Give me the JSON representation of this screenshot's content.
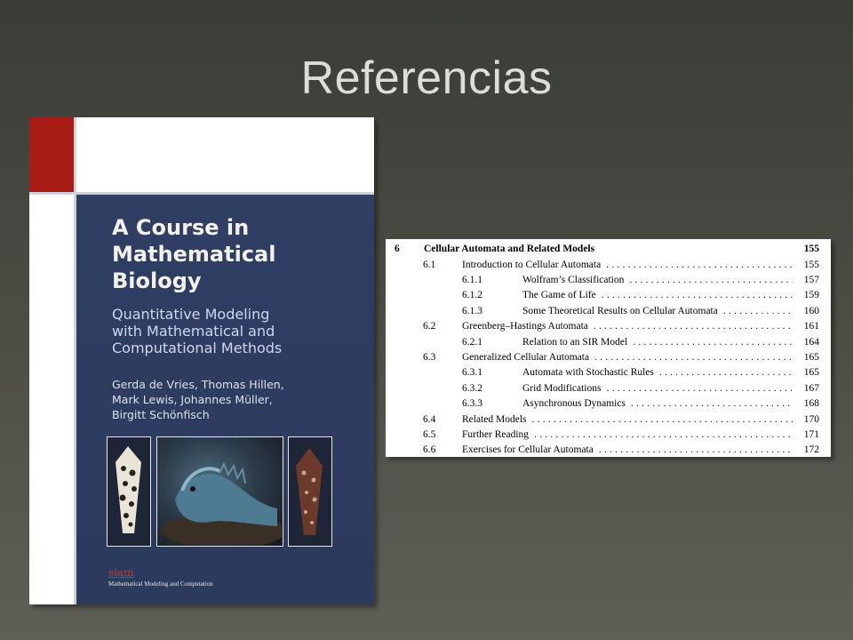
{
  "slide": {
    "title": "Referencias"
  },
  "book_cover": {
    "title_lines": [
      "A Course in",
      "Mathematical",
      "Biology"
    ],
    "subtitle_lines": [
      "Quantitative Modeling",
      "with Mathematical and",
      "Computational Methods"
    ],
    "author_lines": [
      "Gerda de Vries, Thomas Hillen,",
      "Mark Lewis, Johannes Müller,",
      "Birgitt Schönfisch"
    ],
    "publisher_logo": "siam",
    "series": "Mathematical Modeling and Computation",
    "accent_color": "#a81c16",
    "cover_color": "#2f3e63"
  },
  "toc": {
    "chapter": {
      "number": "6",
      "title": "Cellular Automata and Related Models",
      "page": "155"
    },
    "entries": [
      {
        "number": "6.1",
        "title": "Introduction to Cellular Automata",
        "page": "155",
        "level": 1
      },
      {
        "number": "6.1.1",
        "title": "Wolfram’s Classification",
        "page": "157",
        "level": 2
      },
      {
        "number": "6.1.2",
        "title": "The Game of Life",
        "page": "159",
        "level": 2
      },
      {
        "number": "6.1.3",
        "title": "Some Theoretical Results on Cellular Automata",
        "page": "160",
        "level": 2
      },
      {
        "number": "6.2",
        "title": "Greenberg–Hastings Automata",
        "page": "161",
        "level": 1
      },
      {
        "number": "6.2.1",
        "title": "Relation to an SIR Model",
        "page": "164",
        "level": 2
      },
      {
        "number": "6.3",
        "title": "Generalized Cellular Automata",
        "page": "165",
        "level": 1
      },
      {
        "number": "6.3.1",
        "title": "Automata with Stochastic Rules",
        "page": "165",
        "level": 2
      },
      {
        "number": "6.3.2",
        "title": "Grid Modifications",
        "page": "167",
        "level": 2
      },
      {
        "number": "6.3.3",
        "title": "Asynchronous Dynamics",
        "page": "168",
        "level": 2
      },
      {
        "number": "6.4",
        "title": "Related Models",
        "page": "170",
        "level": 1
      },
      {
        "number": "6.5",
        "title": "Further Reading",
        "page": "171",
        "level": 1
      },
      {
        "number": "6.6",
        "title": "Exercises for Cellular Automata",
        "page": "172",
        "level": 1
      }
    ]
  }
}
